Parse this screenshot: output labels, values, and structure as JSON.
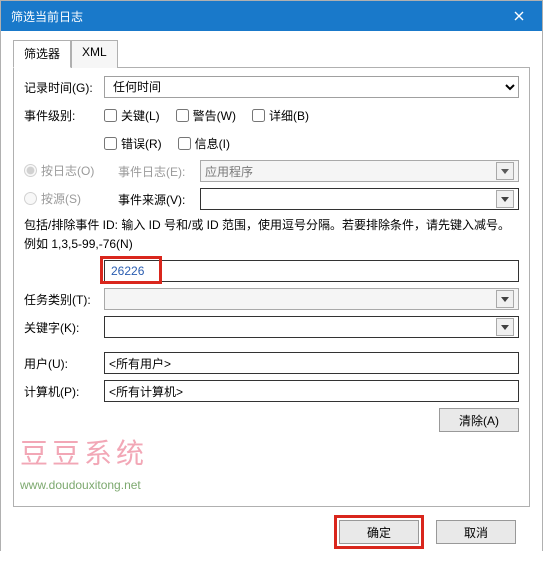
{
  "title": "筛选当前日志",
  "tabs": {
    "filter": "筛选器",
    "xml": "XML"
  },
  "labels": {
    "logged": "记录时间(G):",
    "level": "事件级别:",
    "byLog": "按日志(O)",
    "bySource": "按源(S)",
    "eventLog": "事件日志(E):",
    "eventSource": "事件来源(V):",
    "hint": "包括/排除事件 ID: 输入 ID 号和/或 ID 范围，使用逗号分隔。若要排除条件，请先键入减号。例如 1,3,5-99,-76(N)",
    "taskCategory": "任务类别(T):",
    "keywords": "关键字(K):",
    "user": "用户(U):",
    "computer": "计算机(P):"
  },
  "checkboxes": {
    "critical": "关键(L)",
    "warning": "警告(W)",
    "verbose": "详细(B)",
    "error": "错误(R)",
    "info": "信息(I)"
  },
  "values": {
    "anytime": "任何时间",
    "appLog": "应用程序",
    "eventid": "26226",
    "allUsers": "<所有用户>",
    "allComputers": "<所有计算机>"
  },
  "buttons": {
    "clear": "清除(A)",
    "ok": "确定",
    "cancel": "取消"
  },
  "watermark": {
    "brand": "豆豆系统",
    "url": "www.doudouxitong.net"
  }
}
